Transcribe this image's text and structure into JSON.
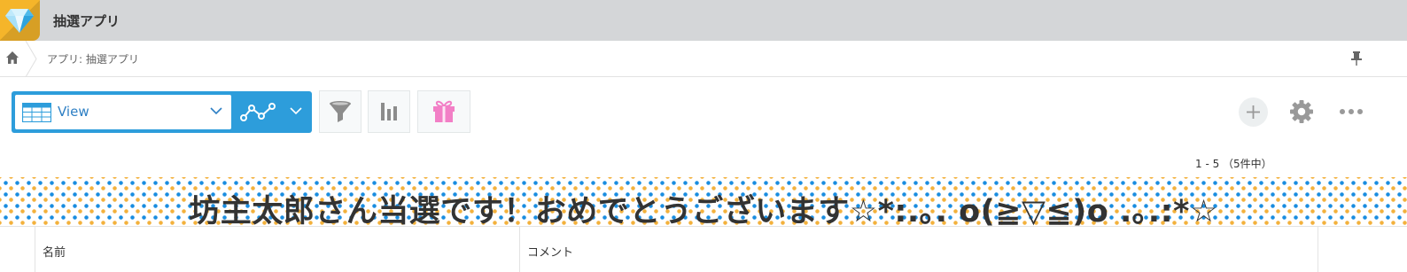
{
  "header": {
    "app_icon": "diamond-icon",
    "app_title": "抽選アプリ"
  },
  "breadcrumb": {
    "home_icon": "home-icon",
    "text": "アプリ: 抽選アプリ",
    "pin_icon": "pin-icon"
  },
  "toolbar": {
    "view_label": "View",
    "icons": {
      "view": "table-icon",
      "graph": "line-graph-icon",
      "filter": "funnel-icon",
      "chart": "bar-chart-icon",
      "gift": "gift-icon",
      "add": "plus-icon",
      "settings": "gear-icon",
      "more": "ellipsis-icon"
    },
    "colors": {
      "accent": "#2d9ddb",
      "gift": "#f27fc6"
    }
  },
  "pager": {
    "text": "1 - 5 （5件中）"
  },
  "banner": {
    "text": "坊主太郎さん当選です！おめでとうございます☆*:.｡. o(≧▽≦)o .｡.:*☆",
    "colors": {
      "dot_primary": "#1a8de0",
      "dot_secondary": "#f3b13c"
    }
  },
  "table": {
    "columns": [
      "名前",
      "コメント"
    ]
  }
}
